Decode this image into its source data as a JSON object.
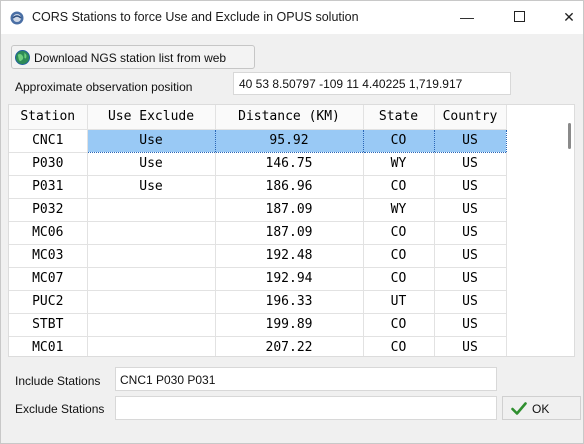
{
  "window": {
    "title": "CORS Stations to force Use and Exclude in OPUS solution",
    "minimize_glyph": "—",
    "close_glyph": "✕",
    "app_icon": "app-icon"
  },
  "toolbar": {
    "download_label": "Download NGS station list from web",
    "download_icon": "globe-icon"
  },
  "position": {
    "label": "Approximate observation position",
    "value": "40 53 8.50797 -109 11 4.40225  1,719.917"
  },
  "table": {
    "columns": [
      "Station",
      "Use Exclude",
      "Distance (KM)",
      "State",
      "Country"
    ],
    "rows": [
      [
        "CNC1",
        "Use",
        "95.92",
        "CO",
        "US"
      ],
      [
        "P030",
        "Use",
        "146.75",
        "WY",
        "US"
      ],
      [
        "P031",
        "Use",
        "186.96",
        "CO",
        "US"
      ],
      [
        "P032",
        "",
        "187.09",
        "WY",
        "US"
      ],
      [
        "MC06",
        "",
        "187.09",
        "CO",
        "US"
      ],
      [
        "MC03",
        "",
        "192.48",
        "CO",
        "US"
      ],
      [
        "MC07",
        "",
        "192.94",
        "CO",
        "US"
      ],
      [
        "PUC2",
        "",
        "196.33",
        "UT",
        "US"
      ],
      [
        "STBT",
        "",
        "199.89",
        "CO",
        "US"
      ],
      [
        "MC01",
        "",
        "207.22",
        "CO",
        "US"
      ]
    ],
    "selected_row": 0,
    "selection_color": "#99c9f5"
  },
  "include": {
    "label": "Include Stations",
    "value": "CNC1 P030 P031"
  },
  "exclude": {
    "label": "Exclude Stations",
    "value": ""
  },
  "ok": {
    "label": "OK",
    "icon": "checkmark-icon"
  }
}
